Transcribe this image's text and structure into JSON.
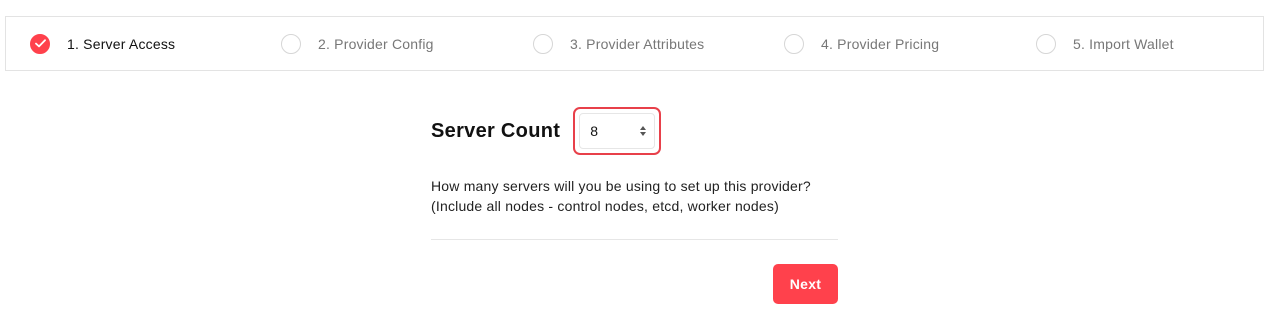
{
  "stepper": {
    "steps": [
      {
        "label": "1. Server Access",
        "status": "completed"
      },
      {
        "label": "2. Provider Config",
        "status": "pending"
      },
      {
        "label": "3. Provider Attributes",
        "status": "pending"
      },
      {
        "label": "4. Provider Pricing",
        "status": "pending"
      },
      {
        "label": "5. Import Wallet",
        "status": "pending"
      }
    ]
  },
  "form": {
    "server_count_label": "Server Count",
    "server_count_value": "8",
    "help_line_1": "How many servers will you be using to set up this provider?",
    "help_line_2": "(Include all nodes - control nodes, etcd, worker nodes)",
    "next_label": "Next"
  },
  "colors": {
    "accent": "#ff414c",
    "border": "#e3e3e3",
    "muted_text": "#777777"
  },
  "icons": {
    "completed_step": "check-icon",
    "spinner": "up-down-arrows-icon"
  }
}
